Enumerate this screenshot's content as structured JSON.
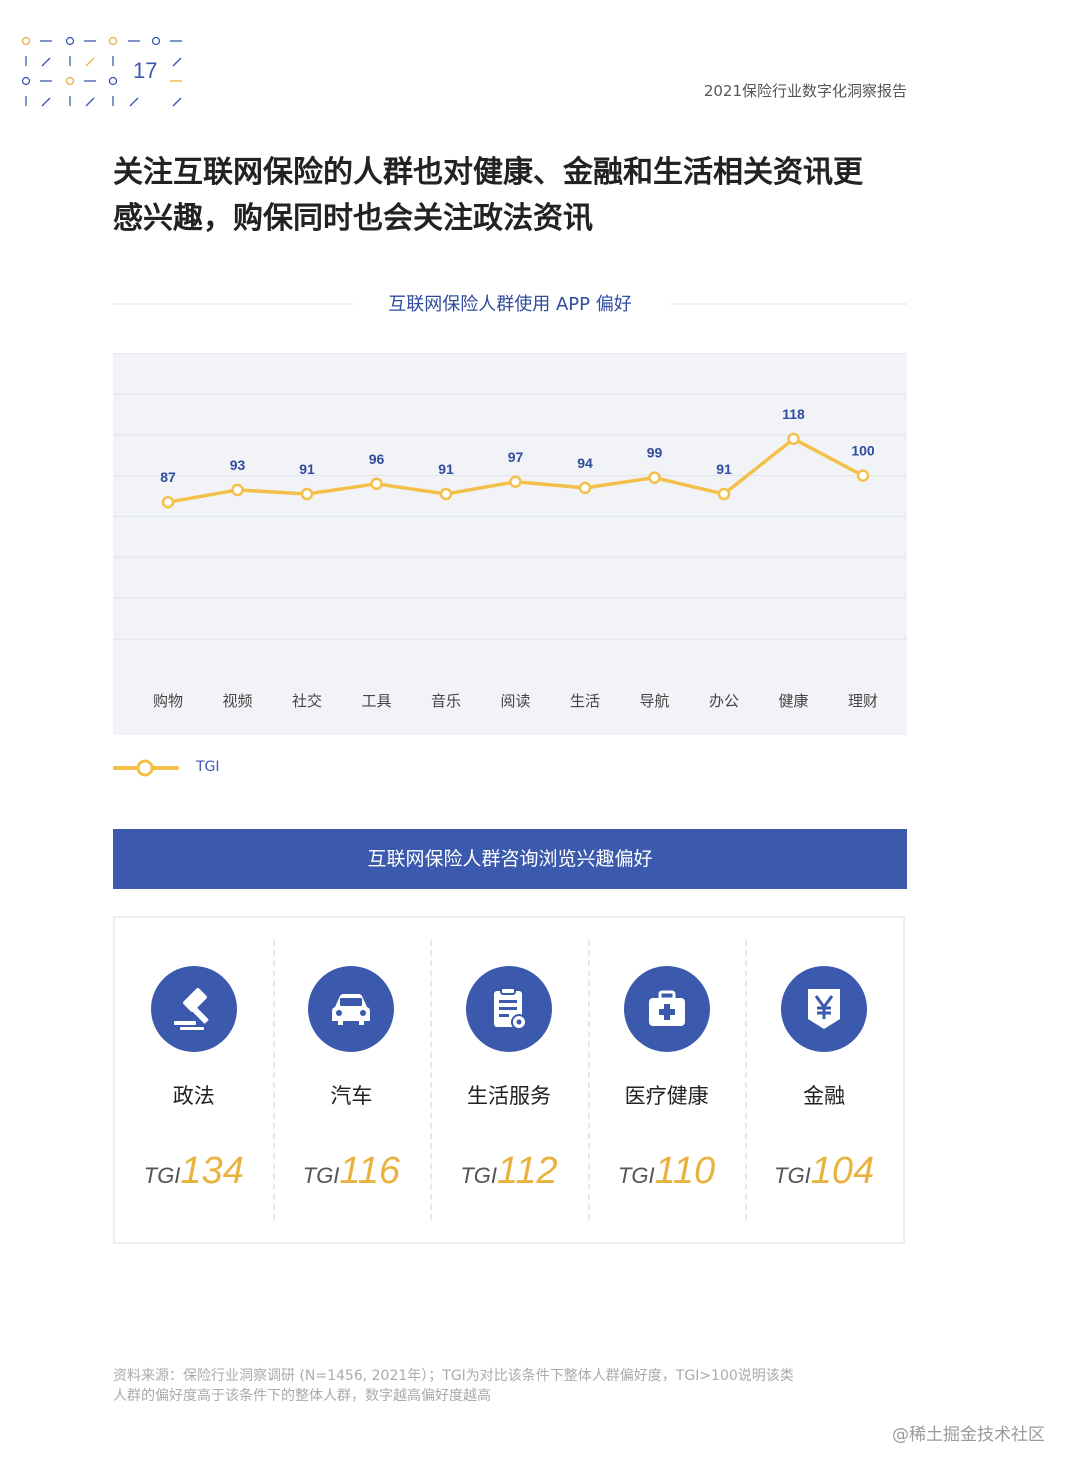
{
  "header": {
    "page_number": "17",
    "report_title": "2021保险行业数字化洞察报告"
  },
  "headline": {
    "line1": "关注互联网保险的人群也对健康、金融和生活相关资讯更",
    "line2": "感兴趣，购保同时也会关注政法资讯"
  },
  "chart_data": {
    "type": "line",
    "title": "互联网保险人群使用 APP 偏好",
    "categories": [
      "购物",
      "视频",
      "社交",
      "工具",
      "音乐",
      "阅读",
      "生活",
      "导航",
      "办公",
      "健康",
      "理财"
    ],
    "series": [
      {
        "name": "TGI",
        "values": [
          87,
          93,
          91,
          96,
          91,
          97,
          94,
          99,
          91,
          118,
          100
        ],
        "color": "#f5c04a"
      }
    ],
    "ylim": [
      0,
      160
    ],
    "grid": true,
    "legend": "bottom-left"
  },
  "legend": {
    "label": "TGI"
  },
  "interests": {
    "title": "互联网保险人群咨询浏览兴趣偏好",
    "prefix": "TGI",
    "items": [
      {
        "name": "政法",
        "tgi": "134",
        "icon": "gavel-icon"
      },
      {
        "name": "汽车",
        "tgi": "116",
        "icon": "car-icon"
      },
      {
        "name": "生活服务",
        "tgi": "112",
        "icon": "clipboard-icon"
      },
      {
        "name": "医疗健康",
        "tgi": "110",
        "icon": "medical-kit-icon"
      },
      {
        "name": "金融",
        "tgi": "104",
        "icon": "yuan-icon"
      }
    ]
  },
  "footnote": {
    "line1": "资料来源：保险行业洞察调研 (N=1456, 2021年）；TGI为对比该条件下整体人群偏好度，TGI>100说明该类",
    "line2": "人群的偏好度高于该条件下的整体人群，数字越高偏好度越高"
  },
  "watermark": "@稀土掘金技术社区",
  "colors": {
    "accent": "#3b5aad",
    "line": "#f5c04a",
    "chart_bg": "#f1f3f7"
  }
}
